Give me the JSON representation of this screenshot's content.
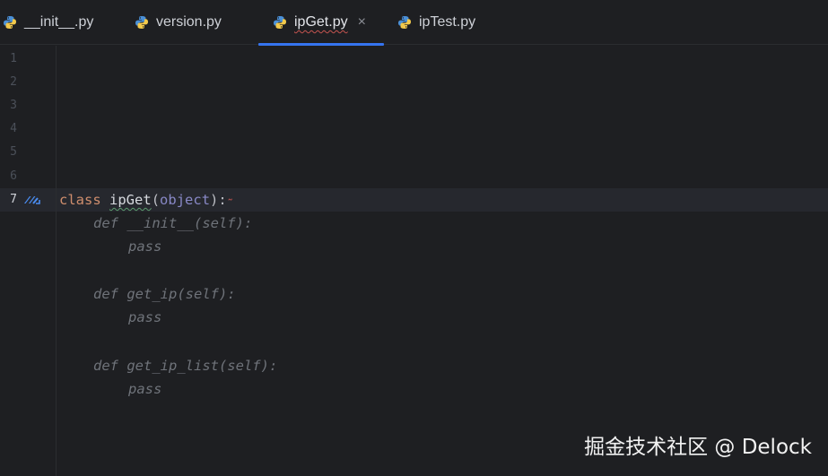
{
  "tabs": [
    {
      "label": "__init__.py",
      "active": false
    },
    {
      "label": "version.py",
      "active": false
    },
    {
      "label": "ipGet.py",
      "active": true,
      "close_glyph": "×"
    },
    {
      "label": "ipTest.py",
      "active": false
    }
  ],
  "icons": {
    "tab_file_icon": "python-file-icon",
    "gutter_icon": "implemented-methods-icon"
  },
  "colors": {
    "active_tab_underline": "#3574f0",
    "keyword": "#cf8e6d",
    "builtin": "#8888c6",
    "muted_code": "#6f737a",
    "error_squiggle": "#c75450"
  },
  "editor": {
    "current_line": 7,
    "line_numbers": [
      "1",
      "2",
      "3",
      "4",
      "5",
      "6",
      "7"
    ],
    "lines": {
      "l7": {
        "keyword": "class",
        "name": "ipGet",
        "open": "(",
        "base": "object",
        "close": "):"
      },
      "l8": "def __init__(self):",
      "l9": "pass",
      "l11": "def get_ip(self):",
      "l12": "pass",
      "l14": "def get_ip_list(self):",
      "l15": "pass"
    }
  },
  "watermark": "掘金技术社区 @ Delock"
}
